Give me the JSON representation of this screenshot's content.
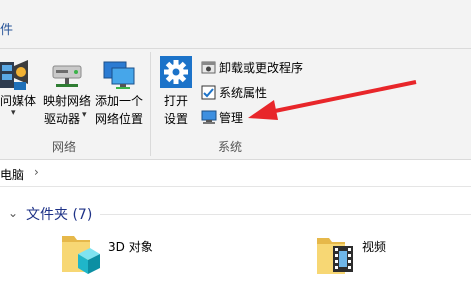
{
  "ribbon": {
    "tab_fragment": "件",
    "network_group": {
      "label": "网络",
      "buttons": [
        {
          "line1": "问媒体",
          "line2": ""
        },
        {
          "line1": "映射网络",
          "line2": "驱动器"
        },
        {
          "line1": "添加一个",
          "line2": "网络位置"
        }
      ]
    },
    "system_group": {
      "label": "系统",
      "open_settings": {
        "line1": "打开",
        "line2": "设置"
      },
      "items": [
        {
          "label": "卸载或更改程序"
        },
        {
          "label": "系统属性"
        },
        {
          "label": "管理"
        }
      ]
    }
  },
  "address": {
    "crumb": "电脑",
    "chevron": "›"
  },
  "content": {
    "section_title": "文件夹 (7)",
    "folders": [
      {
        "label": "3D 对象"
      },
      {
        "label": "视频"
      }
    ]
  },
  "annotation": {
    "arrow_color": "#e8262a"
  }
}
